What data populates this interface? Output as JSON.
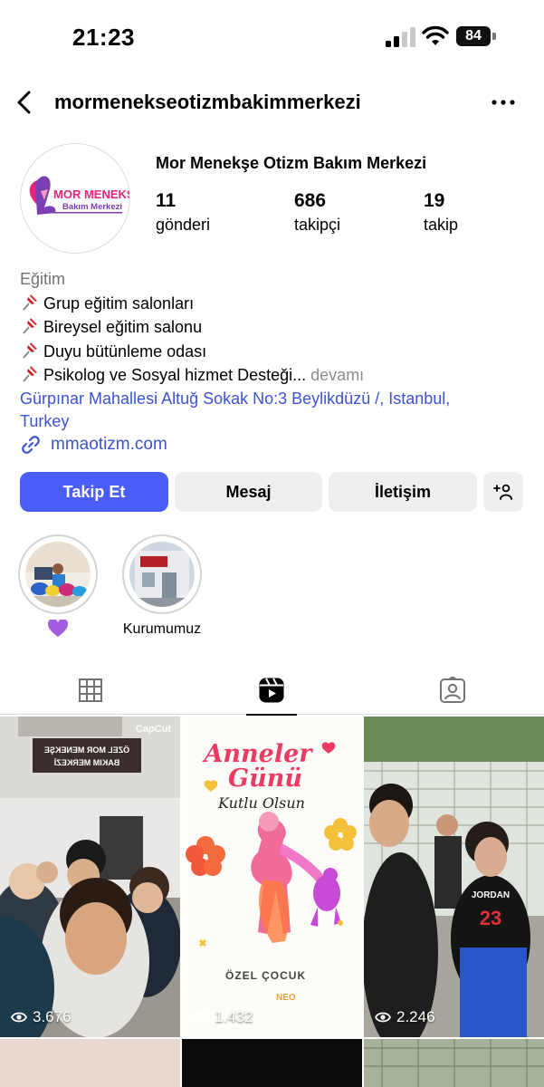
{
  "status_bar": {
    "time": "21:23",
    "battery": "84"
  },
  "header": {
    "username": "mormenekseotizmbakimmerkezi"
  },
  "profile": {
    "full_name": "Mor Menekşe Otizm Bakım Merkezi",
    "logo_line1": "MOR MENEKŞE",
    "logo_line2": "Bakım Merkezi",
    "stats": [
      {
        "value": "11",
        "label": "gönderi"
      },
      {
        "value": "686",
        "label": "takipçi"
      },
      {
        "value": "19",
        "label": "takip"
      }
    ],
    "category": "Eğitim",
    "bio_lines": [
      "Grup eğitim salonları",
      "Bireysel eğitim salonu",
      "Duyu bütünleme odası",
      "Psikolog ve Sosyal hizmet Desteği..."
    ],
    "more_label": "devamı",
    "address_line1": "Gürpınar Mahallesi Altuğ Sokak No:3 Beylikdüzü /, Istanbul,",
    "address_line2": "Turkey",
    "website": "mmaotizm.com"
  },
  "actions": {
    "follow": "Takip Et",
    "message": "Mesaj",
    "contact": "İletişim"
  },
  "highlights": [
    {
      "label": "",
      "emoji": "purple-heart"
    },
    {
      "label": "Kurumumuz"
    }
  ],
  "tabs": [
    "grid-icon",
    "reels-icon",
    "tagged-icon"
  ],
  "reels": [
    {
      "views": "3.676",
      "sign_line1": "ÖZEL MOR MENEKŞE",
      "sign_line2": "BAKIM MERKEZİ",
      "watermark": "CapCut"
    },
    {
      "views": "1.432",
      "title_line1": "Anneler",
      "title_line2": "Günü",
      "subtitle": "Kutlu Olsun",
      "footer1": "ÖZEL ÇOCUK",
      "footer2": "NEO"
    },
    {
      "views": "2.246",
      "jersey_text": "JORDAN",
      "jersey_number": "23"
    }
  ],
  "colors": {
    "accent": "#4a5df9",
    "link": "#3d52d5",
    "button_bg": "#efefef"
  }
}
